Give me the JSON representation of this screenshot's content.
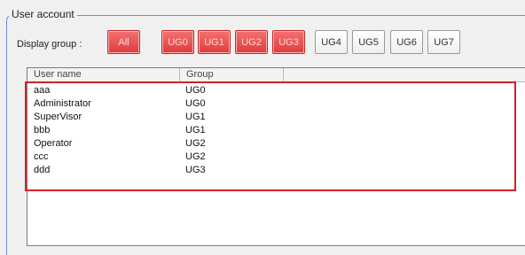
{
  "groupbox": {
    "title": "User account"
  },
  "display_group": {
    "label": "Display group :",
    "buttons": [
      {
        "label": "All",
        "active": true
      },
      {
        "label": "UG0",
        "active": true
      },
      {
        "label": "UG1",
        "active": true
      },
      {
        "label": "UG2",
        "active": true
      },
      {
        "label": "UG3",
        "active": true
      },
      {
        "label": "UG4",
        "active": false
      },
      {
        "label": "UG5",
        "active": false
      },
      {
        "label": "UG6",
        "active": false
      },
      {
        "label": "UG7",
        "active": false
      }
    ]
  },
  "table": {
    "columns": [
      "User name",
      "Group"
    ],
    "rows": [
      {
        "user": "aaa",
        "group": "UG0"
      },
      {
        "user": "Administrator",
        "group": "UG0"
      },
      {
        "user": "SuperVisor",
        "group": "UG1"
      },
      {
        "user": "bbb",
        "group": "UG1"
      },
      {
        "user": "Operator",
        "group": "UG2"
      },
      {
        "user": "ccc",
        "group": "UG2"
      },
      {
        "user": "ddd",
        "group": "UG3"
      }
    ]
  },
  "colors": {
    "active_button": "#e13a3a",
    "highlight_border": "#d4202a",
    "groupbox_border": "#6b8fc9"
  }
}
